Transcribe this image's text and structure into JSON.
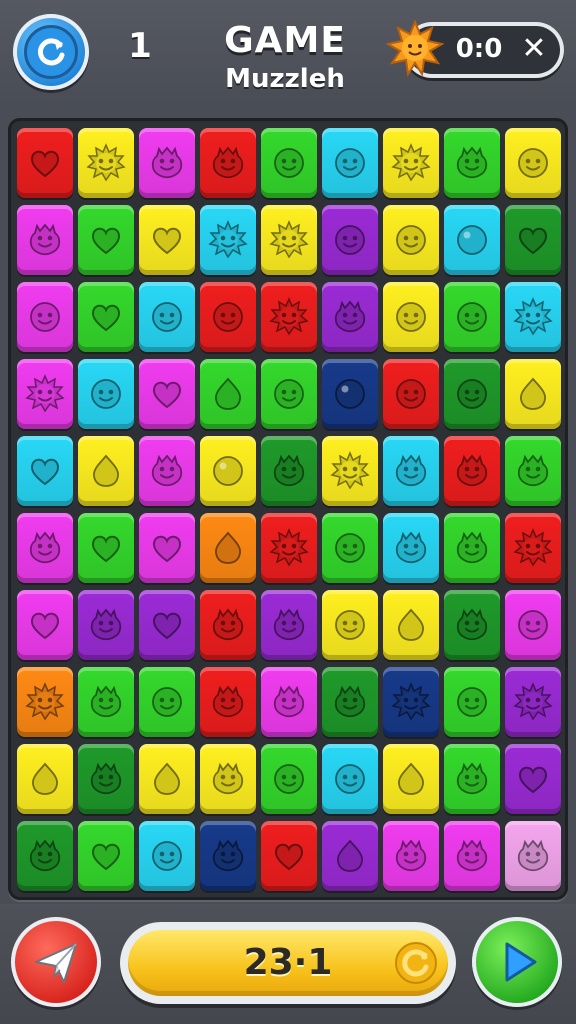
{
  "header": {
    "level": "1",
    "title": "GAME",
    "subtitle": "Muzzleh",
    "score": "0:0",
    "close_glyph": "✕",
    "restart_icon": "restart-icon",
    "badge_icon": "sun-icon"
  },
  "footer": {
    "moves": "23·1",
    "share_icon": "paper-plane-icon",
    "play_icon": "play-icon",
    "refresh_icon": "refresh-icon"
  },
  "colors": {
    "red": "#f01e1e",
    "yellow": "#fff020",
    "magenta": "#f03cf0",
    "green": "#34d92c",
    "cyan": "#28d8f6",
    "purple": "#9b2bd6",
    "darkgreen": "#1f9a2a",
    "orange": "#ff8a14",
    "darkred": "#d8161a",
    "navy": "#173a8a",
    "pink": "#f4a6ee"
  },
  "board": {
    "rows": 10,
    "cols": 9,
    "tiles": [
      [
        [
          "red",
          "heart"
        ],
        [
          "yellow",
          "sun"
        ],
        [
          "magenta",
          "blob"
        ],
        [
          "red",
          "blob"
        ],
        [
          "green",
          "face"
        ],
        [
          "cyan",
          "face"
        ],
        [
          "yellow",
          "sun"
        ],
        [
          "green",
          "blob"
        ],
        [
          "yellow",
          "face"
        ]
      ],
      [
        [
          "magenta",
          "blob"
        ],
        [
          "green",
          "heart"
        ],
        [
          "yellow",
          "heart"
        ],
        [
          "cyan",
          "sun"
        ],
        [
          "yellow",
          "sun"
        ],
        [
          "purple",
          "face"
        ],
        [
          "yellow",
          "face"
        ],
        [
          "cyan",
          "ball"
        ],
        [
          "darkgreen",
          "heart"
        ]
      ],
      [
        [
          "magenta",
          "face"
        ],
        [
          "green",
          "heart"
        ],
        [
          "cyan",
          "face"
        ],
        [
          "red",
          "face"
        ],
        [
          "red",
          "sun"
        ],
        [
          "purple",
          "blob"
        ],
        [
          "yellow",
          "face"
        ],
        [
          "green",
          "face"
        ],
        [
          "cyan",
          "sun"
        ]
      ],
      [
        [
          "magenta",
          "sun"
        ],
        [
          "cyan",
          "face"
        ],
        [
          "magenta",
          "heart"
        ],
        [
          "green",
          "drop"
        ],
        [
          "green",
          "face"
        ],
        [
          "navy",
          "ball"
        ],
        [
          "red",
          "face"
        ],
        [
          "darkgreen",
          "face"
        ],
        [
          "yellow",
          "drop"
        ]
      ],
      [
        [
          "cyan",
          "heart"
        ],
        [
          "yellow",
          "drop"
        ],
        [
          "magenta",
          "blob"
        ],
        [
          "yellow",
          "ball"
        ],
        [
          "darkgreen",
          "blob"
        ],
        [
          "yellow",
          "sun"
        ],
        [
          "cyan",
          "blob"
        ],
        [
          "red",
          "blob"
        ],
        [
          "green",
          "blob"
        ]
      ],
      [
        [
          "magenta",
          "blob"
        ],
        [
          "green",
          "heart"
        ],
        [
          "magenta",
          "heart"
        ],
        [
          "orange",
          "drop"
        ],
        [
          "red",
          "sun"
        ],
        [
          "green",
          "face"
        ],
        [
          "cyan",
          "blob"
        ],
        [
          "green",
          "blob"
        ],
        [
          "red",
          "sun"
        ]
      ],
      [
        [
          "magenta",
          "heart"
        ],
        [
          "purple",
          "blob"
        ],
        [
          "purple",
          "heart"
        ],
        [
          "red",
          "blob"
        ],
        [
          "purple",
          "blob"
        ],
        [
          "yellow",
          "face"
        ],
        [
          "yellow",
          "drop"
        ],
        [
          "darkgreen",
          "blob"
        ],
        [
          "magenta",
          "face"
        ]
      ],
      [
        [
          "orange",
          "sun"
        ],
        [
          "green",
          "blob"
        ],
        [
          "green",
          "face"
        ],
        [
          "red",
          "blob"
        ],
        [
          "magenta",
          "blob"
        ],
        [
          "darkgreen",
          "blob"
        ],
        [
          "navy",
          "sun"
        ],
        [
          "green",
          "face"
        ],
        [
          "purple",
          "sun"
        ]
      ],
      [
        [
          "yellow",
          "drop"
        ],
        [
          "darkgreen",
          "blob"
        ],
        [
          "yellow",
          "drop"
        ],
        [
          "yellow",
          "blob"
        ],
        [
          "green",
          "face"
        ],
        [
          "cyan",
          "face"
        ],
        [
          "yellow",
          "drop"
        ],
        [
          "green",
          "blob"
        ],
        [
          "purple",
          "heart"
        ]
      ],
      [
        [
          "darkgreen",
          "blob"
        ],
        [
          "green",
          "heart"
        ],
        [
          "cyan",
          "face"
        ],
        [
          "navy",
          "blob"
        ],
        [
          "red",
          "heart"
        ],
        [
          "purple",
          "drop"
        ],
        [
          "magenta",
          "blob"
        ],
        [
          "magenta",
          "blob"
        ],
        [
          "pink",
          "blob"
        ]
      ]
    ]
  }
}
